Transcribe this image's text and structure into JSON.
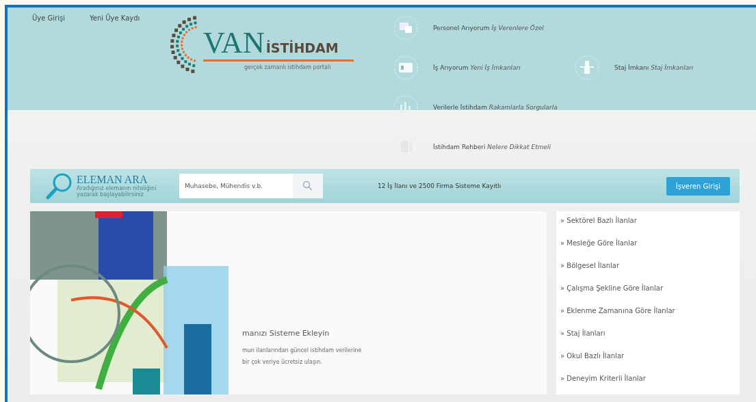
{
  "top_links": [
    "Üye Girişi",
    "Yeni Üye Kaydı"
  ],
  "logo": {
    "main": "VAN",
    "suffix": "İSTİHDAM",
    "tagline": "gerçek zamanlı istihdam portalı"
  },
  "nav": [
    {
      "label": "Personel Arıyorum",
      "tagline": "İş Verenlere Özel"
    },
    {
      "label": "İş Arıyorum",
      "tagline": "Yeni İş İmkanları"
    },
    {
      "label": "Staj İmkanı",
      "tagline": "Staj İmkanları"
    },
    {
      "label": "Verilerle İstihdam",
      "tagline": "Rakamlarla Sorgularla"
    },
    {
      "label": "İstihdam Rehberi",
      "tagline": "Nelere Dikkat Etmeli"
    }
  ],
  "search": {
    "title": "ELEMAN ARA",
    "hint": "Aradığınız elemanın niteliğini yazarak başlayabilirsiniz",
    "placeholder": "Muhasebe, Mühendis v.b.",
    "stats": "12 İş İlanı ve 2500 Firma Sisteme Kayıtlı",
    "button": "İşveren Girişi"
  },
  "banner": {
    "title": "manızı Sisteme Ekleyin",
    "lines": [
      "mun ilanlarından güncel istihdam verilerine",
      "bir çok veriye ücretsiz ulaşın."
    ]
  },
  "categories": [
    "» Sektörel Bazlı İlanlar",
    "» Mesleğe Göre İlanlar",
    "» Bölgesel İlanlar",
    "» Çalışma Şekline Göre İlanlar",
    "» Eklenme Zamanına Göre İlanlar",
    "» Staj İlanları",
    "» Okul Bazlı İlanlar",
    "» Deneyim Kriterli İlanlar"
  ]
}
